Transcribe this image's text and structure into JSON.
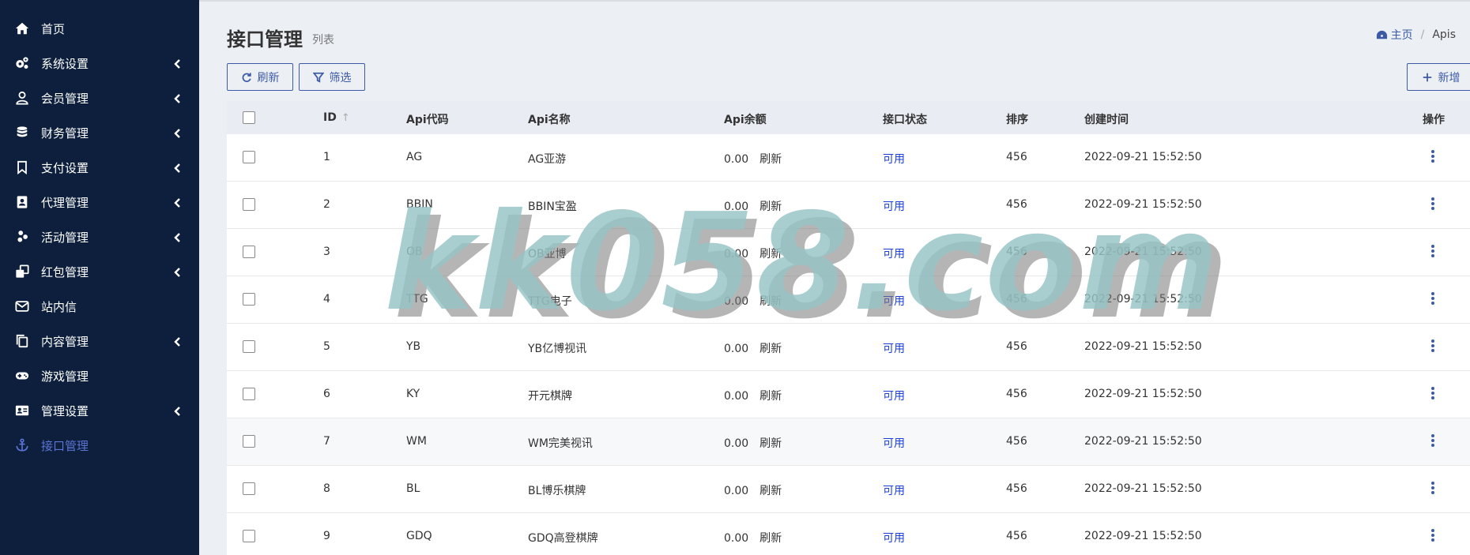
{
  "sidebar": {
    "items": [
      {
        "label": "首页",
        "icon": "home-icon",
        "has_submenu": false
      },
      {
        "label": "系统设置",
        "icon": "gears-icon",
        "has_submenu": true
      },
      {
        "label": "会员管理",
        "icon": "user-icon",
        "has_submenu": true
      },
      {
        "label": "财务管理",
        "icon": "database-icon",
        "has_submenu": true
      },
      {
        "label": "支付设置",
        "icon": "bookmark-icon",
        "has_submenu": true
      },
      {
        "label": "代理管理",
        "icon": "id-badge-icon",
        "has_submenu": true
      },
      {
        "label": "活动管理",
        "icon": "pinwheel-icon",
        "has_submenu": true
      },
      {
        "label": "红包管理",
        "icon": "clone-icon",
        "has_submenu": true
      },
      {
        "label": "站内信",
        "icon": "envelope-icon",
        "has_submenu": false
      },
      {
        "label": "内容管理",
        "icon": "copy-icon",
        "has_submenu": true
      },
      {
        "label": "游戏管理",
        "icon": "gamepad-icon",
        "has_submenu": false
      },
      {
        "label": "管理设置",
        "icon": "address-card-icon",
        "has_submenu": true
      },
      {
        "label": "接口管理",
        "icon": "anchor-icon",
        "has_submenu": false,
        "active": true
      }
    ]
  },
  "header": {
    "title": "接口管理",
    "subtitle": "列表",
    "breadcrumb": {
      "home": "主页",
      "current": "Apis"
    }
  },
  "toolbar": {
    "refresh_label": "刷新",
    "filter_label": "筛选",
    "new_label": "新增"
  },
  "table": {
    "columns": {
      "id": "ID",
      "code": "Api代码",
      "name": "Api名称",
      "balance": "Api余额",
      "status": "接口状态",
      "sort": "排序",
      "created": "创建时间",
      "actions": "操作"
    },
    "rows": [
      {
        "id": "1",
        "code": "AG",
        "name": "AG亚游",
        "balance": "0.00",
        "refresh": "刷新",
        "status": "可用",
        "sort": "456",
        "created": "2022-09-21 15:52:50"
      },
      {
        "id": "2",
        "code": "BBIN",
        "name": "BBIN宝盈",
        "balance": "0.00",
        "refresh": "刷新",
        "status": "可用",
        "sort": "456",
        "created": "2022-09-21 15:52:50"
      },
      {
        "id": "3",
        "code": "OB",
        "name": "OB亚博",
        "balance": "0.00",
        "refresh": "刷新",
        "status": "可用",
        "sort": "456",
        "created": "2022-09-21 15:52:50"
      },
      {
        "id": "4",
        "code": "TTG",
        "name": "TTG电子",
        "balance": "0.00",
        "refresh": "刷新",
        "status": "可用",
        "sort": "456",
        "created": "2022-09-21 15:52:50"
      },
      {
        "id": "5",
        "code": "YB",
        "name": "YB亿博视讯",
        "balance": "0.00",
        "refresh": "刷新",
        "status": "可用",
        "sort": "456",
        "created": "2022-09-21 15:52:50"
      },
      {
        "id": "6",
        "code": "KY",
        "name": "开元棋牌",
        "balance": "0.00",
        "refresh": "刷新",
        "status": "可用",
        "sort": "456",
        "created": "2022-09-21 15:52:50"
      },
      {
        "id": "7",
        "code": "WM",
        "name": "WM完美视讯",
        "balance": "0.00",
        "refresh": "刷新",
        "status": "可用",
        "sort": "456",
        "created": "2022-09-21 15:52:50"
      },
      {
        "id": "8",
        "code": "BL",
        "name": "BL博乐棋牌",
        "balance": "0.00",
        "refresh": "刷新",
        "status": "可用",
        "sort": "456",
        "created": "2022-09-21 15:52:50"
      },
      {
        "id": "9",
        "code": "GDQ",
        "name": "GDQ高登棋牌",
        "balance": "0.00",
        "refresh": "刷新",
        "status": "可用",
        "sort": "456",
        "created": "2022-09-21 15:52:50"
      }
    ]
  },
  "watermark": "kk058.com",
  "colors": {
    "sidebar_bg": "#0d1f3c",
    "accent": "#3c5aa6",
    "status_available": "#1a3ee0",
    "page_bg": "#ecf0f5"
  }
}
